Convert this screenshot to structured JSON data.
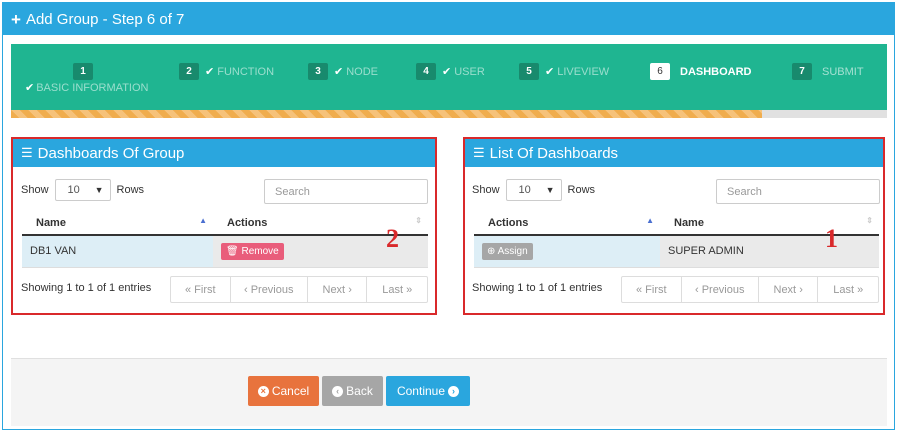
{
  "window": {
    "title": "Add Group - Step 6 of 7"
  },
  "wizard": {
    "progress": 0.857,
    "steps": [
      {
        "num": "1",
        "label": "BASIC INFORMATION",
        "state": "done"
      },
      {
        "num": "2",
        "label": "FUNCTION",
        "state": "done"
      },
      {
        "num": "3",
        "label": "NODE",
        "state": "done"
      },
      {
        "num": "4",
        "label": "USER",
        "state": "done"
      },
      {
        "num": "5",
        "label": "LIVEVIEW",
        "state": "done"
      },
      {
        "num": "6",
        "label": "DASHBOARD",
        "state": "active"
      },
      {
        "num": "7",
        "label": "SUBMIT",
        "state": "future"
      }
    ]
  },
  "left_panel": {
    "title": "Dashboards Of Group",
    "show_label": "Show",
    "rows_value": "10",
    "rows_label": "Rows",
    "search_placeholder": "Search",
    "columns": [
      "Name",
      "Actions"
    ],
    "rows": [
      {
        "name": "DB1 VAN",
        "action": "Remove"
      }
    ],
    "info": "Showing 1 to 1 of 1 entries",
    "pager": {
      "first": "First",
      "previous": "Previous",
      "next": "Next",
      "last": "Last"
    },
    "annotation": "2"
  },
  "right_panel": {
    "title": "List Of Dashboards",
    "show_label": "Show",
    "rows_value": "10",
    "rows_label": "Rows",
    "search_placeholder": "Search",
    "columns": [
      "Actions",
      "Name"
    ],
    "rows": [
      {
        "action": "Assign",
        "name": "SUPER ADMIN"
      }
    ],
    "info": "Showing 1 to 1 of 1 entries",
    "pager": {
      "first": "First",
      "previous": "Previous",
      "next": "Next",
      "last": "Last"
    },
    "annotation": "1"
  },
  "footer": {
    "cancel": "Cancel",
    "back": "Back",
    "continue": "Continue"
  },
  "colors": {
    "header": "#2aa6de",
    "wizard": "#1fb591",
    "cancel": "#e8733d",
    "back": "#a6a6a6",
    "continue": "#2aa6de",
    "remove": "#e95d7b",
    "highlight": "#d9292b"
  }
}
